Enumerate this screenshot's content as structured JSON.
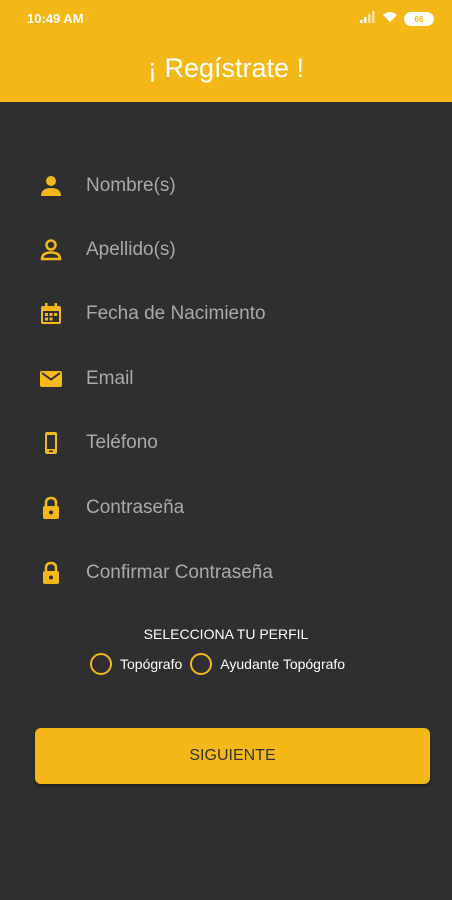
{
  "status_bar": {
    "time": "10:49 AM",
    "battery": "66",
    "signal_icon": "signal-icon",
    "wifi_icon": "wifi-icon"
  },
  "header": {
    "title": "¡ Regístrate !"
  },
  "form": {
    "fields": [
      {
        "placeholder": "Nombre(s)",
        "value": "",
        "icon": "person-icon"
      },
      {
        "placeholder": "Apellido(s)",
        "value": "",
        "icon": "person-outline-icon"
      },
      {
        "placeholder": "Fecha de Nacimiento",
        "value": "",
        "icon": "calendar-icon"
      },
      {
        "placeholder": "Email",
        "value": "",
        "icon": "email-icon"
      },
      {
        "placeholder": "Teléfono",
        "value": "",
        "icon": "phone-icon"
      },
      {
        "placeholder": "Contraseña",
        "value": "",
        "icon": "lock-icon"
      },
      {
        "placeholder": "Confirmar Contraseña",
        "value": "",
        "icon": "lock-icon"
      }
    ]
  },
  "profile": {
    "label": "SELECCIONA TU PERFIL",
    "options": [
      "Topógrafo",
      "Ayudante Topógrafo"
    ]
  },
  "actions": {
    "next_label": "SIGUIENTE"
  },
  "colors": {
    "accent": "#f4b918",
    "background": "#2f2f2f",
    "placeholder": "#a9a9a9"
  }
}
